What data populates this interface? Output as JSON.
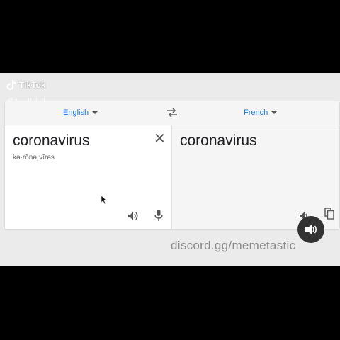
{
  "overlay": {
    "tiktok_label": "TikTok",
    "tiktok_username": "@a_ _ll_l_ll",
    "watermark": "discord.gg/memetastic"
  },
  "translator": {
    "source_language": "English",
    "target_language": "French",
    "source_text": "coronavirus",
    "transliteration": "kə·rōnə͵vīrəs",
    "translated_text": "coronavirus"
  },
  "colors": {
    "link_blue": "#1a73e8",
    "card_bg": "#ffffff",
    "panel_bg": "#f5f5f5"
  },
  "icons": [
    "tiktok-logo-icon",
    "swap-languages-icon",
    "clear-text-icon",
    "speaker-icon",
    "microphone-icon",
    "copy-icon",
    "mouse-pointer-icon",
    "sound-toggle-icon"
  ]
}
